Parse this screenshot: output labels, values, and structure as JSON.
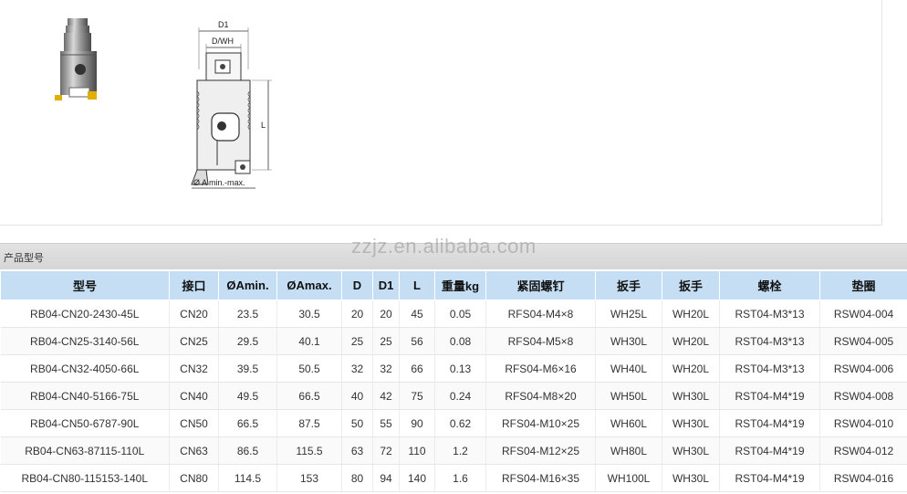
{
  "drawing": {
    "dim_d1": "D1",
    "dim_d_wh": "D/WH",
    "dim_l": "L",
    "dim_a": "Ø A min.-max."
  },
  "section": {
    "title": "产品型号"
  },
  "watermark": "zzjz.en.alibaba.com",
  "table": {
    "headers": [
      "型号",
      "接口",
      "ØAmin.",
      "ØAmax.",
      "D",
      "D1",
      "L",
      "重量kg",
      "紧固螺钉",
      "扳手",
      "扳手",
      "螺栓",
      "垫圈"
    ],
    "rows": [
      [
        "RB04-CN20-2430-45L",
        "CN20",
        "23.5",
        "30.5",
        "20",
        "20",
        "45",
        "0.05",
        "RFS04-M4×8",
        "WH25L",
        "WH20L",
        "RST04-M3*13",
        "RSW04-004"
      ],
      [
        "RB04-CN25-3140-56L",
        "CN25",
        "29.5",
        "40.1",
        "25",
        "25",
        "56",
        "0.08",
        "RFS04-M5×8",
        "WH30L",
        "WH20L",
        "RST04-M3*13",
        "RSW04-005"
      ],
      [
        "RB04-CN32-4050-66L",
        "CN32",
        "39.5",
        "50.5",
        "32",
        "32",
        "66",
        "0.13",
        "RFS04-M6×16",
        "WH40L",
        "WH20L",
        "RST04-M3*13",
        "RSW04-006"
      ],
      [
        "RB04-CN40-5166-75L",
        "CN40",
        "49.5",
        "66.5",
        "40",
        "42",
        "75",
        "0.24",
        "RFS04-M8×20",
        "WH50L",
        "WH30L",
        "RST04-M4*19",
        "RSW04-008"
      ],
      [
        "RB04-CN50-6787-90L",
        "CN50",
        "66.5",
        "87.5",
        "50",
        "55",
        "90",
        "0.62",
        "RFS04-M10×25",
        "WH60L",
        "WH30L",
        "RST04-M4*19",
        "RSW04-010"
      ],
      [
        "RB04-CN63-87115-110L",
        "CN63",
        "86.5",
        "115.5",
        "63",
        "72",
        "110",
        "1.2",
        "RFS04-M12×25",
        "WH80L",
        "WH30L",
        "RST04-M4*19",
        "RSW04-012"
      ],
      [
        "RB04-CN80-115153-140L",
        "CN80",
        "114.5",
        "153",
        "80",
        "94",
        "140",
        "1.6",
        "RFS04-M16×35",
        "WH100L",
        "WH30L",
        "RST04-M4*19",
        "RSW04-016"
      ]
    ]
  }
}
